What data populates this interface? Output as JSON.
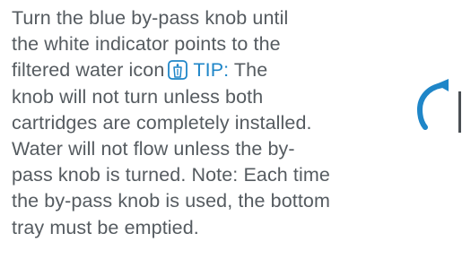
{
  "instructions": {
    "line1": "Turn the blue by-pass knob until",
    "line2": "the white indicator points to the",
    "line3_before_icon": "filtered water icon",
    "tip_label": "TIP:",
    "line3_after_tip": " The",
    "line4": "knob will not turn unless both",
    "line5": "cartridges are completely installed.",
    "line6": "Water will not flow unless the by-",
    "line7": "pass knob is turned. Note: Each time",
    "line8": "the by-pass knob is used, the bottom",
    "line9": "tray must be emptied."
  },
  "icons": {
    "filter_icon": "filtered-water-icon",
    "arrow": "curved-arrow-icon"
  },
  "colors": {
    "text": "#555b60",
    "accent_blue": "#1f86c8"
  }
}
